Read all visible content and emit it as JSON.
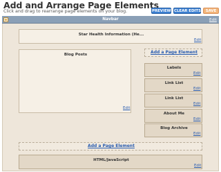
{
  "header": {
    "title": "Add and Arrange Page Elements",
    "subtitle": "Click and drag to rearrange page elements on your blog.",
    "preview_label": "PREVIEW",
    "clear_label": "CLEAR EDITS",
    "save_label": "SAVE"
  },
  "navbar": {
    "title": "Navbar",
    "edit_label": "Edit"
  },
  "header_gadget": {
    "title": "Star Health Information (He...",
    "edit_label": "Edit"
  },
  "main": {
    "blog_posts_title": "Blog Posts",
    "blog_posts_edit": "Edit",
    "add_element_label": "Add a Page Element"
  },
  "sidebar": {
    "add_element_label": "Add a Page Element",
    "items": [
      {
        "title": "Labels",
        "edit_label": "Edit"
      },
      {
        "title": "Link List",
        "edit_label": "Edit"
      },
      {
        "title": "Link List",
        "edit_label": "Edit"
      },
      {
        "title": "About Me",
        "edit_label": "Edit"
      },
      {
        "title": "Blog Archive",
        "edit_label": "Edit"
      }
    ]
  },
  "footer_gadget": {
    "title": "HTML/JavaScript",
    "edit_label": "Edit"
  },
  "colors": {
    "navbar": "#8a9fb6",
    "canvas": "#eee6da",
    "preview_button": "#3b7fd1",
    "save_button": "#f2b57a",
    "link": "#2a5db0"
  }
}
